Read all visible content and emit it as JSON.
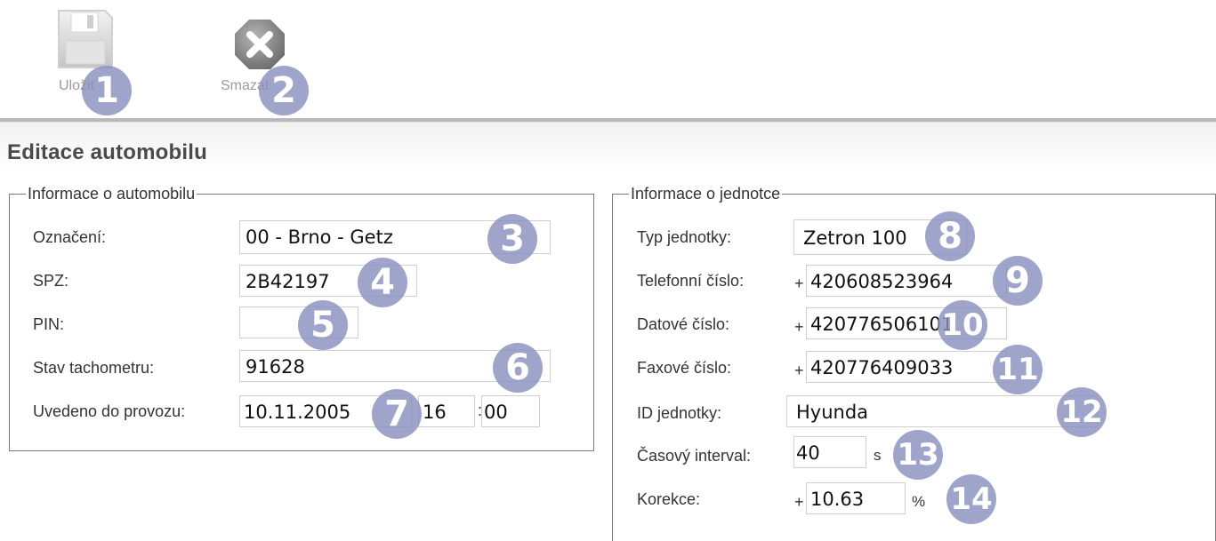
{
  "toolbar": {
    "save_label": "Uložit",
    "delete_label": "Smazat"
  },
  "page_title": "Editace automobilu",
  "car_info": {
    "legend": "Informace o automobilu",
    "designation_label": "Označení:",
    "designation_value": "00 - Brno - Getz",
    "plate_label": "SPZ:",
    "plate_value": "2B42197",
    "pin_label": "PIN:",
    "pin_value": "",
    "odometer_label": "Stav tachometru:",
    "odometer_value": "91628",
    "commissioned_label": "Uvedeno do provozu:",
    "commissioned_date": "10.11.2005",
    "commissioned_hour": "16",
    "time_sep": ":",
    "commissioned_minute": "00"
  },
  "unit_info": {
    "legend": "Informace o jednotce",
    "type_label": "Typ jednotky:",
    "type_value": "Zetron 100",
    "phone_label": "Telefonní číslo:",
    "phone_prefix": "+",
    "phone_value": "420608523964",
    "data_label": "Datové číslo:",
    "data_prefix": "+",
    "data_value": "420776506101",
    "fax_label": "Faxové číslo:",
    "fax_prefix": "+",
    "fax_value": "420776409033",
    "id_label": "ID jednotky:",
    "id_value": "Hyunda",
    "interval_label": "Časový interval:",
    "interval_value": "40",
    "interval_unit": "s",
    "correction_label": "Korekce:",
    "correction_prefix": "+",
    "correction_value": "10.63",
    "correction_unit": "%"
  },
  "badges": [
    "1",
    "2",
    "3",
    "4",
    "5",
    "6",
    "7",
    "8",
    "9",
    "10",
    "11",
    "12",
    "13",
    "14"
  ],
  "colors": {
    "badge": "#8a90be",
    "separator": "#b9b9b9",
    "delete_icon": "#8a8a8a"
  },
  "icons": {
    "save": "floppy-disk-icon",
    "delete": "x-circle-icon"
  }
}
